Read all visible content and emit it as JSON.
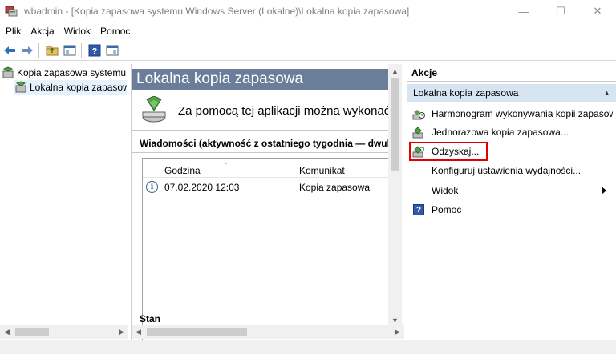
{
  "window": {
    "title": "wbadmin - [Kopia zapasowa systemu Windows Server (Lokalne)\\Lokalna kopia zapasowa]",
    "minimize_glyph": "—",
    "maximize_glyph": "☐",
    "close_glyph": "✕"
  },
  "menu": {
    "items": [
      "Plik",
      "Akcja",
      "Widok",
      "Pomoc"
    ]
  },
  "toolbar": {
    "buttons": [
      "back-icon",
      "forward-icon",
      "folder-up-icon",
      "show-hide-tree-icon",
      "help-icon",
      "show-hide-action-pane-icon"
    ]
  },
  "tree": {
    "root_label": "Kopia zapasowa systemu Windows Server (Lokalne)",
    "child_label": "Lokalna kopia zapasowa"
  },
  "main": {
    "header": "Lokalna kopia zapasowa",
    "intro": "Za pomocą tej aplikacji można wykonać",
    "messages_title": "Wiadomości (aktywność z ostatniego tygodnia — dwukrotnie kliknij komunikat, aby wyświetlić szczegóły)",
    "columns": [
      "Godzina",
      "Komunikat"
    ],
    "rows": [
      {
        "time": "07.02.2020 12:03",
        "message": "Kopia zapasowa"
      }
    ],
    "status_title": "Stan"
  },
  "actions": {
    "header": "Akcje",
    "subheader": "Lokalna kopia zapasowa",
    "items": [
      {
        "label": "Harmonogram wykonywania kopii zapasowej..."
      },
      {
        "label": "Jednorazowa kopia zapasowa..."
      },
      {
        "label": "Odzyskaj..."
      },
      {
        "label": "Konfiguruj ustawienia wydajności..."
      },
      {
        "label": "Widok"
      },
      {
        "label": "Pomoc"
      }
    ]
  },
  "colors": {
    "header_bg": "#6b7e99",
    "action_subheader_bg": "#d7e4f2",
    "highlight": "#e00000",
    "tree_selection": "#e5f1fb"
  }
}
